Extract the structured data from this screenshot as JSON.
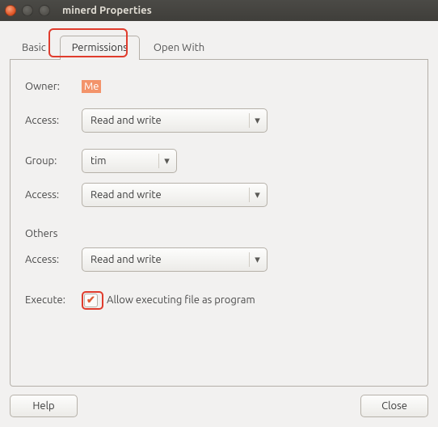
{
  "window": {
    "title": "minerd Properties"
  },
  "tabs": {
    "basic": "Basic",
    "permissions": "Permissions",
    "openwith": "Open With"
  },
  "owner": {
    "label": "Owner:",
    "value": "Me"
  },
  "owner_access": {
    "label": "Access:",
    "value": "Read and write"
  },
  "group": {
    "label": "Group:",
    "value": "tim"
  },
  "group_access": {
    "label": "Access:",
    "value": "Read and write"
  },
  "others": {
    "section": "Others"
  },
  "others_access": {
    "label": "Access:",
    "value": "Read and write"
  },
  "execute": {
    "label": "Execute:",
    "checkbox_label": "Allow executing file as program",
    "checked": true
  },
  "footer": {
    "help": "Help",
    "close": "Close"
  },
  "glyphs": {
    "arrow_down": "▾",
    "checkmark": "✔"
  }
}
